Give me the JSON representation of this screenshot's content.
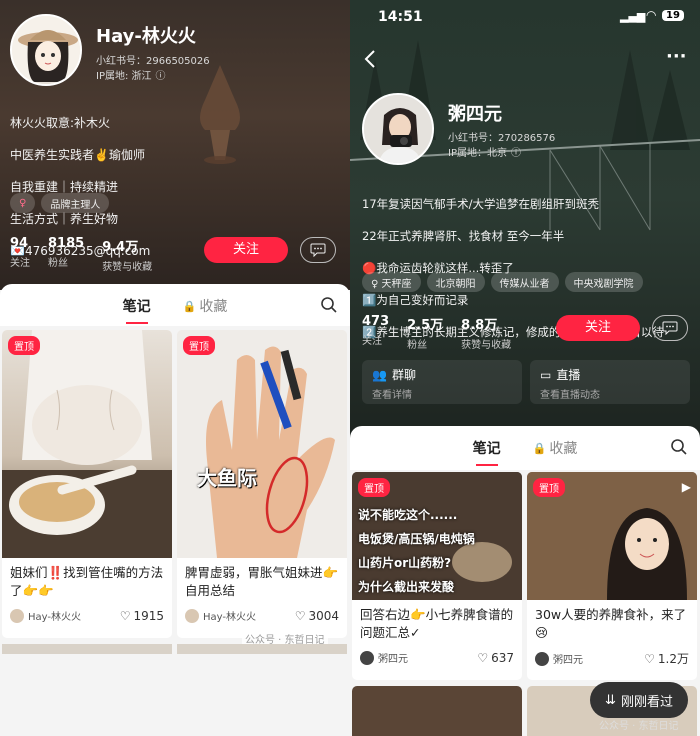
{
  "left": {
    "profile": {
      "name": "Hay-林火火",
      "id_label": "小红书号：2966505026",
      "ip_label": "IP属地: 浙江",
      "bio": [
        "林火火取意:补木火",
        "中医养生实践者✌️瑜伽师",
        "自我重建｜持续精进",
        "生活方式｜养生好物",
        "💌476936235@qq.com"
      ],
      "tags": [
        "♀",
        "品牌主理人"
      ],
      "stats": [
        {
          "num": "94",
          "label": "关注"
        },
        {
          "num": "8185",
          "label": "粉丝"
        },
        {
          "num": "9.4万",
          "label": "获赞与收藏"
        }
      ],
      "follow_label": "关注"
    },
    "tabs": {
      "notes": "笔记",
      "collect": "收藏"
    },
    "notes": [
      {
        "pin": "置顶",
        "title": "姐妹们‼️找到管住嘴的方法了👉👉",
        "author": "Hay-林火火",
        "likes": "1915"
      },
      {
        "pin": "置顶",
        "title": "脾胃虚弱，胃胀气姐妹进👉自用总结",
        "author": "Hay-林火火",
        "likes": "3004",
        "overlay": "大鱼际"
      }
    ],
    "watermark": "公众号 · 东哲日记"
  },
  "right": {
    "status": {
      "time": "14:51",
      "battery": "19"
    },
    "profile": {
      "name": "粥四元",
      "id_label": "小红书号：270286576",
      "ip_label": "IP属地：北京",
      "bio": [
        "17年复读因气郁手术/大学追梦在剧组肝到斑秃",
        "22年正式养脾肾肝、找食材 至今一年半",
        "🔴我命运齿轮就这样...转歪了",
        "1️⃣为自己变好而记录",
        "2️⃣养生博主的长期主义修炼记，修成的话多条路（扶目以待"
      ],
      "tags": [
        "♀ 天秤座",
        "北京朝阳",
        "传媒从业者",
        "中央戏剧学院"
      ],
      "stats": [
        {
          "num": "473",
          "label": "关注"
        },
        {
          "num": "2.5万",
          "label": "粉丝"
        },
        {
          "num": "8.8万",
          "label": "获赞与收藏"
        }
      ],
      "follow_label": "关注"
    },
    "functions": [
      {
        "title": "群聊",
        "sub": "查看详情"
      },
      {
        "title": "直播",
        "sub": "查看直播动态"
      }
    ],
    "tabs": {
      "notes": "笔记",
      "collect": "收藏"
    },
    "notes": [
      {
        "pin": "置顶",
        "title": "回答右边👉小七养脾食谱的问题汇总✓",
        "author": "粥四元",
        "likes": "637",
        "overlay_lines": [
          "说不能吃这个......",
          "电饭煲/高压锅/电炖锅",
          "山药片or山药粉?",
          "为什么截出来发酸"
        ]
      },
      {
        "pin": "置顶",
        "title": "30w人要的养脾食补，来了😢",
        "author": "粥四元",
        "likes": "1.2万"
      }
    ],
    "seen_button": "刚刚看过",
    "watermark": "公众号 · 东哲日记"
  }
}
